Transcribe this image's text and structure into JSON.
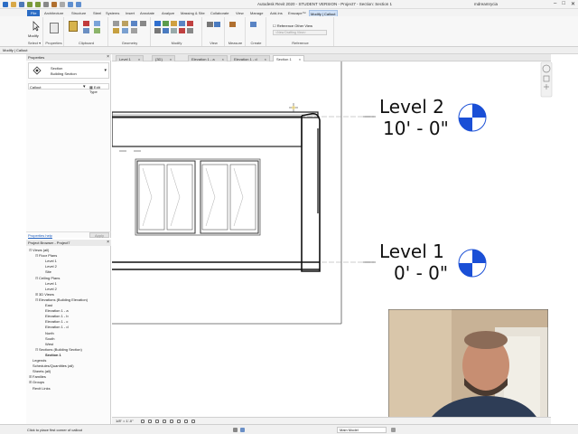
{
  "window": {
    "title": "Autodesk Revit 2020 - STUDENT VERSION - Project7 - Section: Section 1",
    "user": "mdreamrycia"
  },
  "ribbon": {
    "file_tab": "File",
    "tabs": [
      "Architecture",
      "Structure",
      "Steel",
      "Systems",
      "Insert",
      "Annotate",
      "Analyze",
      "Massing & Site",
      "Collaborate",
      "View",
      "Manage",
      "Add-Ins",
      "Enscape™",
      "Modify | Callout"
    ],
    "active_tab": "Modify | Callout",
    "groups": [
      "Select ▾",
      "Properties",
      "Clipboard",
      "Geometry",
      "Modify",
      "View",
      "Measure",
      "Create",
      "Reference"
    ],
    "modify_button": "Modify",
    "reference_options": [
      "Reference Other View",
      "<New Drafting View>"
    ]
  },
  "context_bar": {
    "text": "Modify | Callout"
  },
  "properties": {
    "title": "Properties",
    "type_family": "Section",
    "type_name": "Building Section",
    "instance_label": "Callout",
    "edit_type": "Edit Type",
    "help_link": "Properties help",
    "apply": "Apply"
  },
  "view_tabs": [
    {
      "label": "Level 1",
      "active": false
    },
    {
      "label": "{3D}",
      "active": false
    },
    {
      "label": "Elevation 1 - a",
      "active": false
    },
    {
      "label": "Elevation 1 - d",
      "active": false
    },
    {
      "label": "Section 1",
      "active": true
    }
  ],
  "project_browser": {
    "title": "Project Browser - Project7",
    "nodes": [
      {
        "label": "Views (all)",
        "depth": 0,
        "exp": "⊟"
      },
      {
        "label": "Floor Plans",
        "depth": 1,
        "exp": "⊟"
      },
      {
        "label": "Level 1",
        "depth": 2,
        "exp": ""
      },
      {
        "label": "Level 2",
        "depth": 2,
        "exp": ""
      },
      {
        "label": "Site",
        "depth": 2,
        "exp": ""
      },
      {
        "label": "Ceiling Plans",
        "depth": 1,
        "exp": "⊟"
      },
      {
        "label": "Level 1",
        "depth": 2,
        "exp": ""
      },
      {
        "label": "Level 2",
        "depth": 2,
        "exp": ""
      },
      {
        "label": "3D Views",
        "depth": 1,
        "exp": "⊞"
      },
      {
        "label": "Elevations (Building Elevation)",
        "depth": 1,
        "exp": "⊟"
      },
      {
        "label": "East",
        "depth": 2,
        "exp": ""
      },
      {
        "label": "Elevation 1 - a",
        "depth": 2,
        "exp": ""
      },
      {
        "label": "Elevation 1 - b",
        "depth": 2,
        "exp": ""
      },
      {
        "label": "Elevation 1 - c",
        "depth": 2,
        "exp": ""
      },
      {
        "label": "Elevation 1 - d",
        "depth": 2,
        "exp": ""
      },
      {
        "label": "North",
        "depth": 2,
        "exp": ""
      },
      {
        "label": "South",
        "depth": 2,
        "exp": ""
      },
      {
        "label": "West",
        "depth": 2,
        "exp": ""
      },
      {
        "label": "Sections (Building Section)",
        "depth": 1,
        "exp": "⊟"
      },
      {
        "label": "Section 1",
        "depth": 2,
        "exp": "",
        "bold": true
      },
      {
        "label": "Legends",
        "depth": 0,
        "exp": ""
      },
      {
        "label": "Schedules/Quantities (all)",
        "depth": 0,
        "exp": ""
      },
      {
        "label": "Sheets (all)",
        "depth": 0,
        "exp": ""
      },
      {
        "label": "Families",
        "depth": 0,
        "exp": "⊞"
      },
      {
        "label": "Groups",
        "depth": 0,
        "exp": "⊞"
      },
      {
        "label": "Revit Links",
        "depth": 0,
        "exp": ""
      }
    ]
  },
  "levels": [
    {
      "name": "Level 2",
      "elevation": "10' - 0\""
    },
    {
      "name": "Level 1",
      "elevation": "0' - 0\""
    }
  ],
  "view_control": {
    "scale": "1/8\" = 1'-0\""
  },
  "status": {
    "text": "Click to place first corner of callout",
    "model": "Main Model"
  },
  "colors": {
    "accent": "#2b6cc4",
    "level_head_blue": "#1a4fd6"
  }
}
